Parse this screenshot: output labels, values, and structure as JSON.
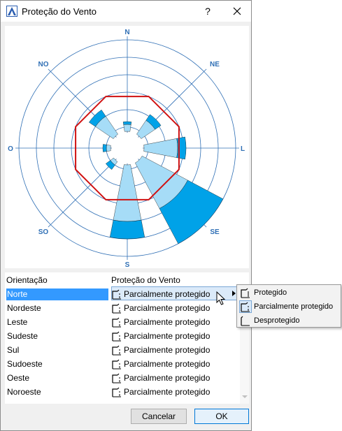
{
  "window": {
    "title": "Proteção do Vento",
    "help_label": "?",
    "close_label": "✕"
  },
  "rose": {
    "directions": {
      "n": "N",
      "ne": "NE",
      "l": "L",
      "se": "SE",
      "s": "S",
      "so": "SO",
      "o": "O",
      "no": "NO"
    },
    "ring_color": "#2f6fb5",
    "sector_dark": "#00a2e8",
    "sector_light": "#a6dcf7",
    "octagon_color": "#d01010"
  },
  "grid": {
    "headers": {
      "orientation": "Orientação",
      "protection": "Proteção do Vento"
    },
    "rows": [
      {
        "orientation": "Norte",
        "protection": "Parcialmente protegido"
      },
      {
        "orientation": "Nordeste",
        "protection": "Parcialmente protegido"
      },
      {
        "orientation": "Leste",
        "protection": "Parcialmente protegido"
      },
      {
        "orientation": "Sudeste",
        "protection": "Parcialmente protegido"
      },
      {
        "orientation": "Sul",
        "protection": "Parcialmente protegido"
      },
      {
        "orientation": "Sudoeste",
        "protection": "Parcialmente protegido"
      },
      {
        "orientation": "Oeste",
        "protection": "Parcialmente protegido"
      },
      {
        "orientation": "Noroeste",
        "protection": "Parcialmente protegido"
      }
    ],
    "selected_color": "#3399ff"
  },
  "menu": {
    "items": [
      {
        "label": "Protegido"
      },
      {
        "label": "Parcialmente protegido"
      },
      {
        "label": "Desprotegido"
      }
    ]
  },
  "buttons": {
    "cancel": "Cancelar",
    "ok": "OK"
  }
}
